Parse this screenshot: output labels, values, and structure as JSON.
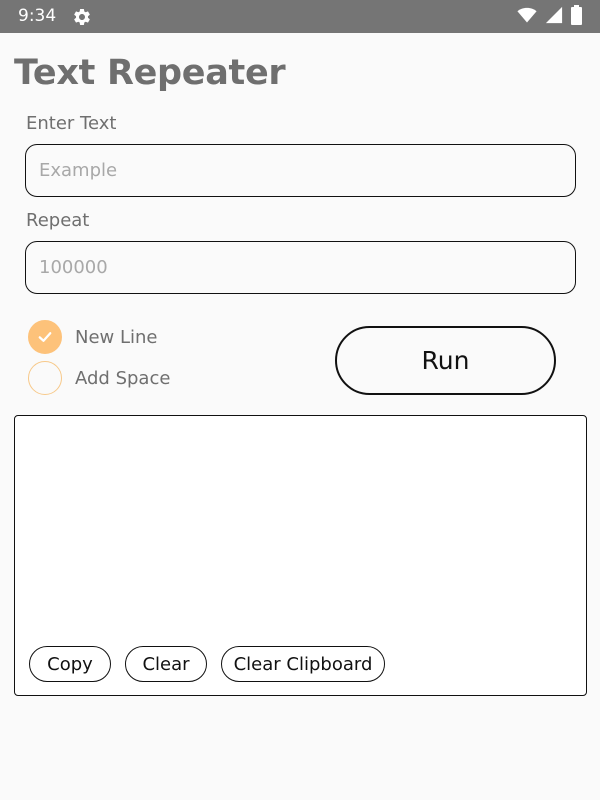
{
  "status_bar": {
    "time": "9:34",
    "icons": [
      "gear-icon",
      "wifi-icon",
      "signal-icon",
      "battery-icon"
    ]
  },
  "app": {
    "title": "Text Repeater"
  },
  "enter_text": {
    "label": "Enter Text",
    "value": "",
    "placeholder": "Example"
  },
  "repeat": {
    "label": "Repeat",
    "value": "",
    "placeholder": "100000"
  },
  "options": {
    "new_line": {
      "label": "New Line",
      "checked": true
    },
    "add_space": {
      "label": "Add Space",
      "checked": false
    }
  },
  "run_button": {
    "label": "Run"
  },
  "output": {
    "text": "",
    "copy_label": "Copy",
    "clear_label": "Clear",
    "clear_clipboard_label": "Clear Clipboard"
  },
  "colors": {
    "status_bar": "#757575",
    "accent": "#fdc27a",
    "background": "#fafafa",
    "label_text": "#6f6f6f"
  }
}
